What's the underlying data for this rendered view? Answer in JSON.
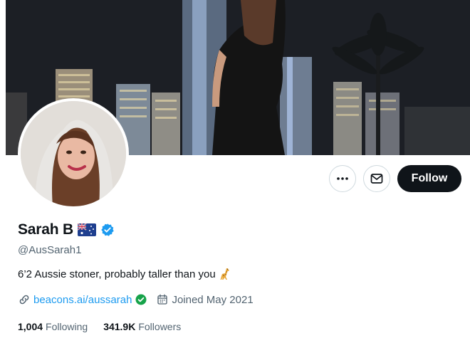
{
  "profile": {
    "display_name": "Sarah B",
    "flag_icon": "australian-flag-icon",
    "verified_icon": "verified-badge-icon",
    "handle": "@AusSarah1",
    "bio_text": "6’2 Aussie stoner, probably taller than you",
    "bio_emoji": "giraffe-emoji-icon",
    "link": "beacons.ai/aussarah",
    "joined": "Joined May 2021",
    "following_count": "1,004",
    "following_label": "Following",
    "followers_count": "341.9K",
    "followers_label": "Followers"
  },
  "actions": {
    "more_icon": "more-horizontal-icon",
    "message_icon": "envelope-icon",
    "follow_label": "Follow"
  },
  "colors": {
    "accent": "#1d9bf0",
    "text_primary": "#0f1419",
    "text_secondary": "#536471",
    "button_dark": "#0f1419",
    "border": "#cfd9de"
  }
}
